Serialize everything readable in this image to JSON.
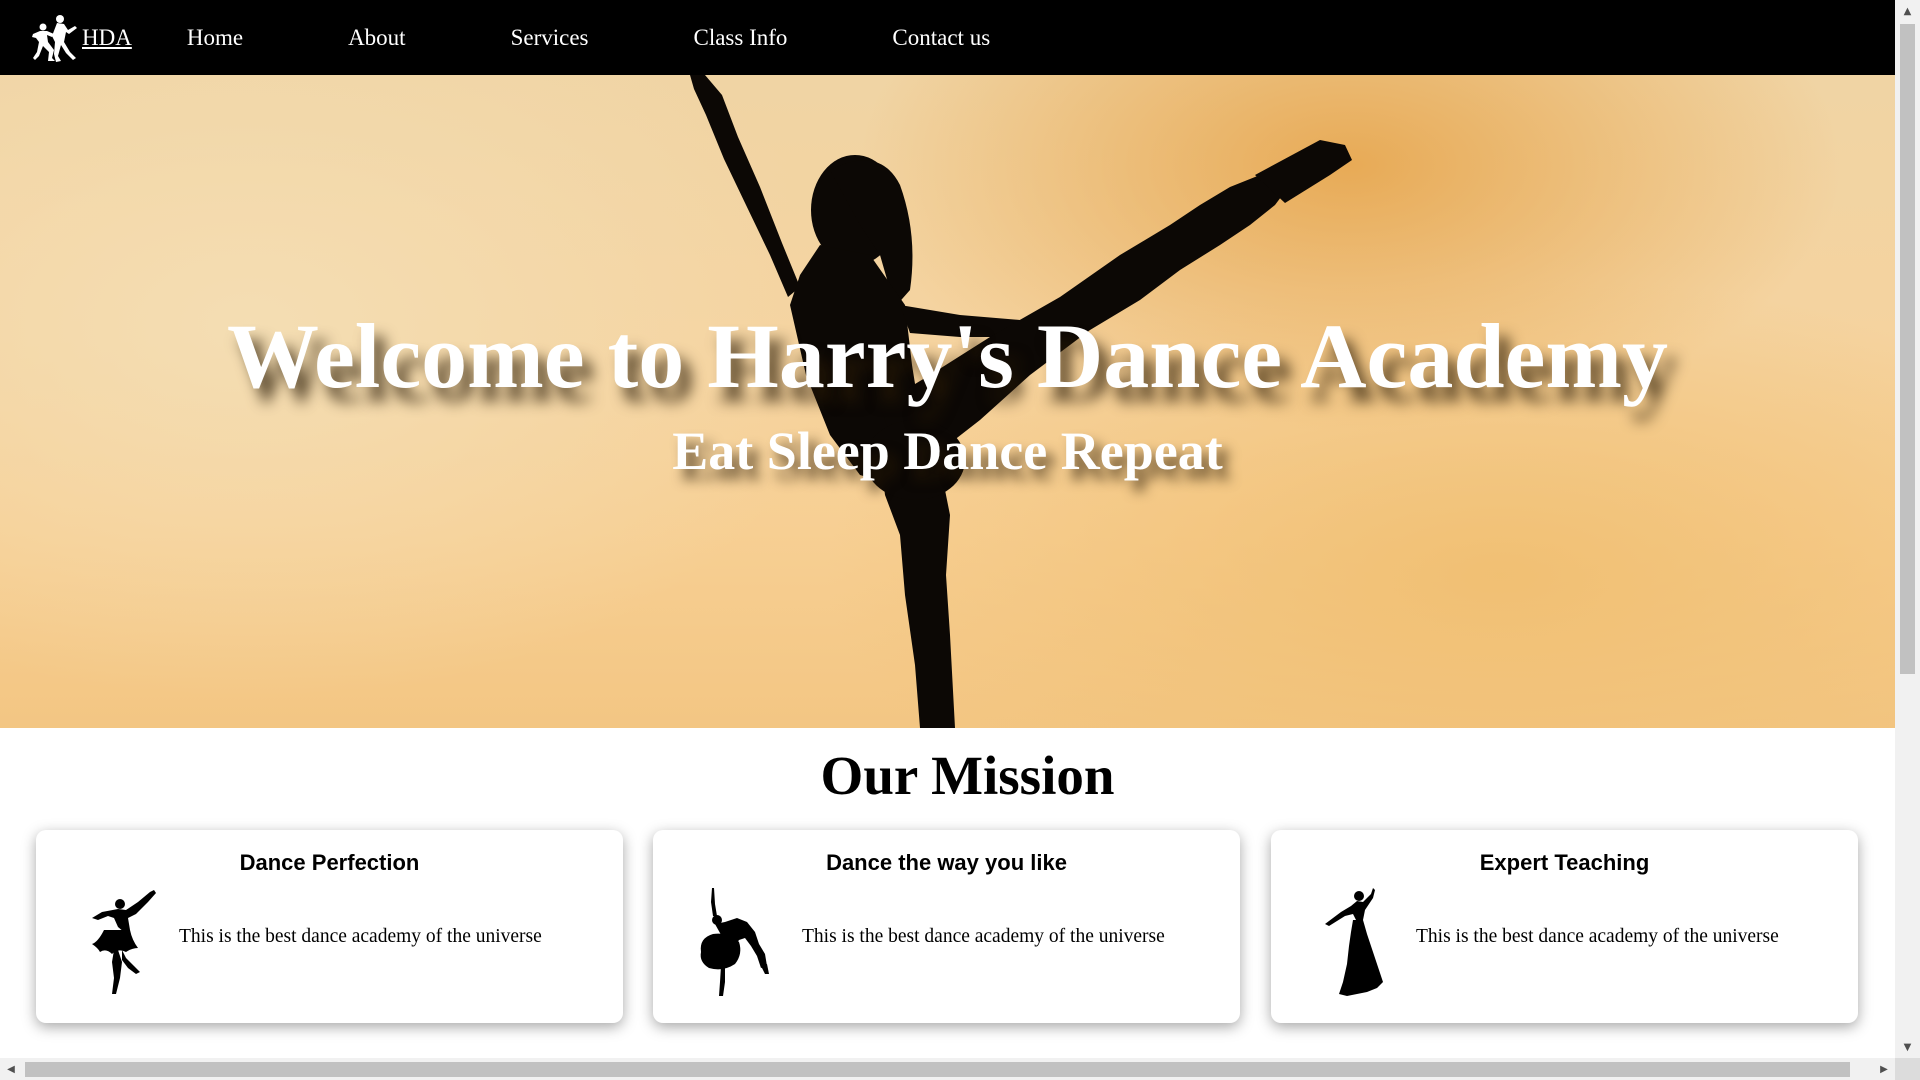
{
  "nav": {
    "brand": "HDA",
    "brand_icon": "dancing-couple-icon",
    "links": [
      {
        "label": "Home"
      },
      {
        "label": "About"
      },
      {
        "label": "Services"
      },
      {
        "label": "Class Info"
      },
      {
        "label": "Contact us"
      }
    ]
  },
  "hero": {
    "title": "Welcome to Harry's Dance Academy",
    "subtitle": "Eat Sleep Dance Repeat",
    "image": "ballerina-silhouette-sunset"
  },
  "mission": {
    "heading": "Our Mission",
    "cards": [
      {
        "title": "Dance Perfection",
        "text": "This is the best dance academy of the universe",
        "icon": "ballerina-tutu-icon"
      },
      {
        "title": "Dance the way you like",
        "text": "This is the best dance academy of the universe",
        "icon": "ballerina-pose-icon"
      },
      {
        "title": "Expert Teaching",
        "text": "This is the best dance academy of the universe",
        "icon": "dancer-gown-icon"
      }
    ]
  },
  "colors": {
    "nav_bg": "#000000",
    "hero_sky": "#f5d39f",
    "text_white": "#ffffff"
  }
}
